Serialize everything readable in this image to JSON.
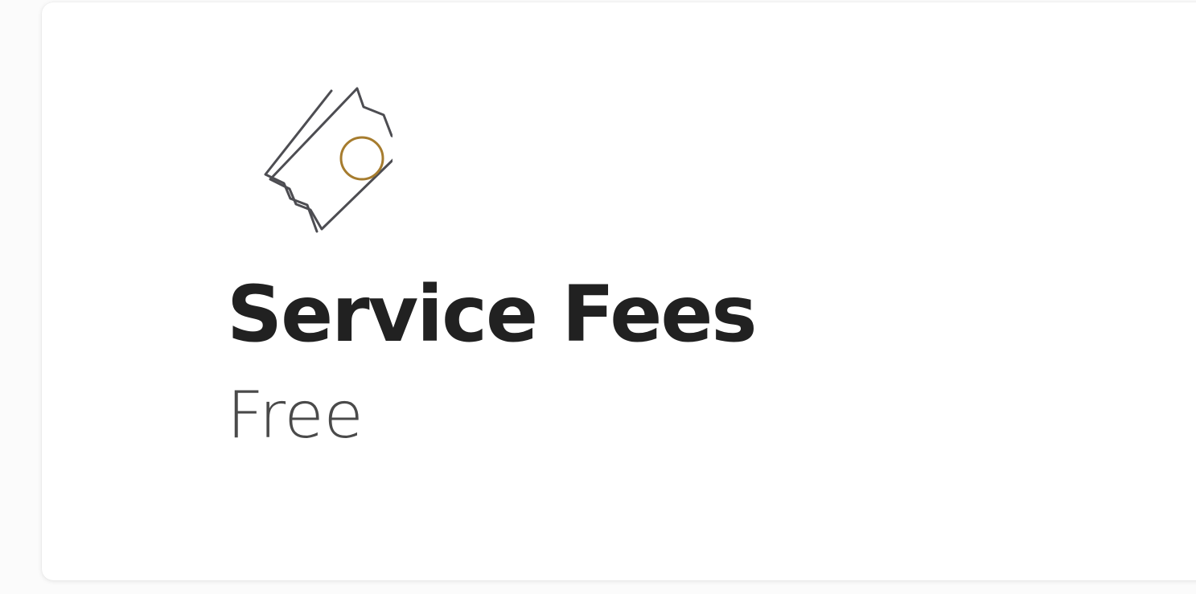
{
  "card": {
    "icon_name": "ticket-icon",
    "title": "Service Fees",
    "value": "Free"
  },
  "colors": {
    "icon_stroke": "#4d4d52",
    "icon_accent": "#a67c2e",
    "title": "#212121",
    "value": "#4a4a4a",
    "card_background": "#ffffff"
  }
}
